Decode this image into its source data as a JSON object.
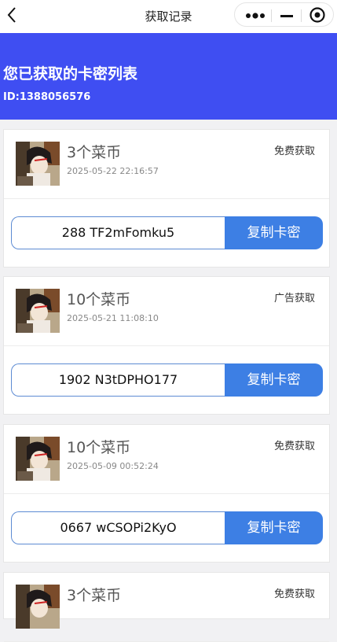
{
  "nav": {
    "title": "获取记录",
    "back_icon": "chevron-left-icon",
    "more_icon": "more-dots-icon",
    "minimize_icon": "minimize-icon",
    "close_icon": "target-icon"
  },
  "header": {
    "title": "您已获取的卡密列表",
    "user_id": "ID:1388056576",
    "background": "#3f4ef2"
  },
  "colors": {
    "copy_button": "#3d7fe4",
    "code_border": "#5d8bd3"
  },
  "cards": [
    {
      "coin": "3个菜币",
      "time": "2025-05-22 22:16:57",
      "source": "免费获取",
      "code": "288 TF2mFomku5",
      "button": "复制卡密"
    },
    {
      "coin": "10个菜币",
      "time": "2025-05-21 11:08:10",
      "source": "广告获取",
      "code": "1902 N3tDPHO177",
      "button": "复制卡密"
    },
    {
      "coin": "10个菜币",
      "time": "2025-05-09 00:52:24",
      "source": "免费获取",
      "code": "0667 wCSOPi2KyO",
      "button": "复制卡密"
    },
    {
      "coin": "3个菜币",
      "source": "免费获取"
    }
  ]
}
